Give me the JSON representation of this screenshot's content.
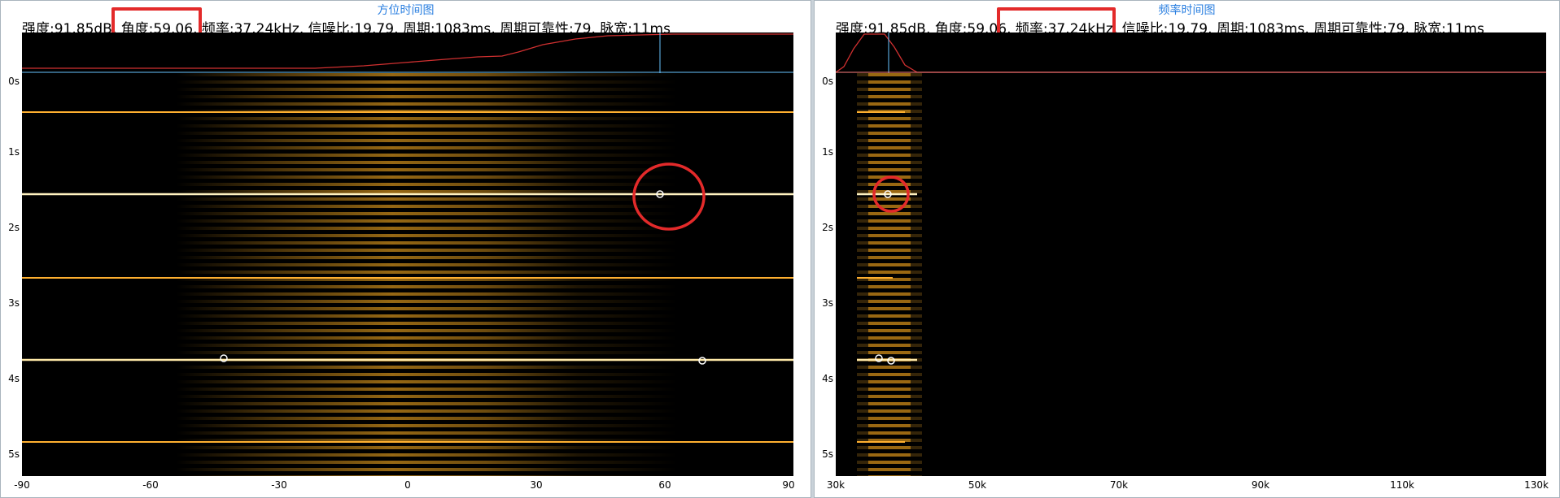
{
  "left_panel": {
    "title": "方位时间图",
    "info": "强度:91.85dB, 角度:59.06, 频率:37.24kHz, 信噪比:19.79, 周期:1083ms, 周期可靠性:79, 脉宽:11ms",
    "y_ticks": [
      "0s",
      "1s",
      "2s",
      "3s",
      "4s",
      "5s"
    ],
    "x_ticks": [
      "-90",
      "-60",
      "-30",
      "0",
      "30",
      "60",
      "90"
    ]
  },
  "right_panel": {
    "title": "频率时间图",
    "info": "强度:91.85dB, 角度:59.06, 频率:37.24kHz, 信噪比:19.79, 周期:1083ms, 周期可靠性:79, 脉宽:11ms",
    "y_ticks": [
      "0s",
      "1s",
      "2s",
      "3s",
      "4s",
      "5s"
    ],
    "x_ticks": [
      "30k",
      "50k",
      "70k",
      "90k",
      "110k",
      "130k"
    ]
  },
  "colors": {
    "trace": "#ffd070",
    "band": "#c88a1a",
    "annotation": "#e32a2a",
    "cursor": "#69c3ff"
  }
}
